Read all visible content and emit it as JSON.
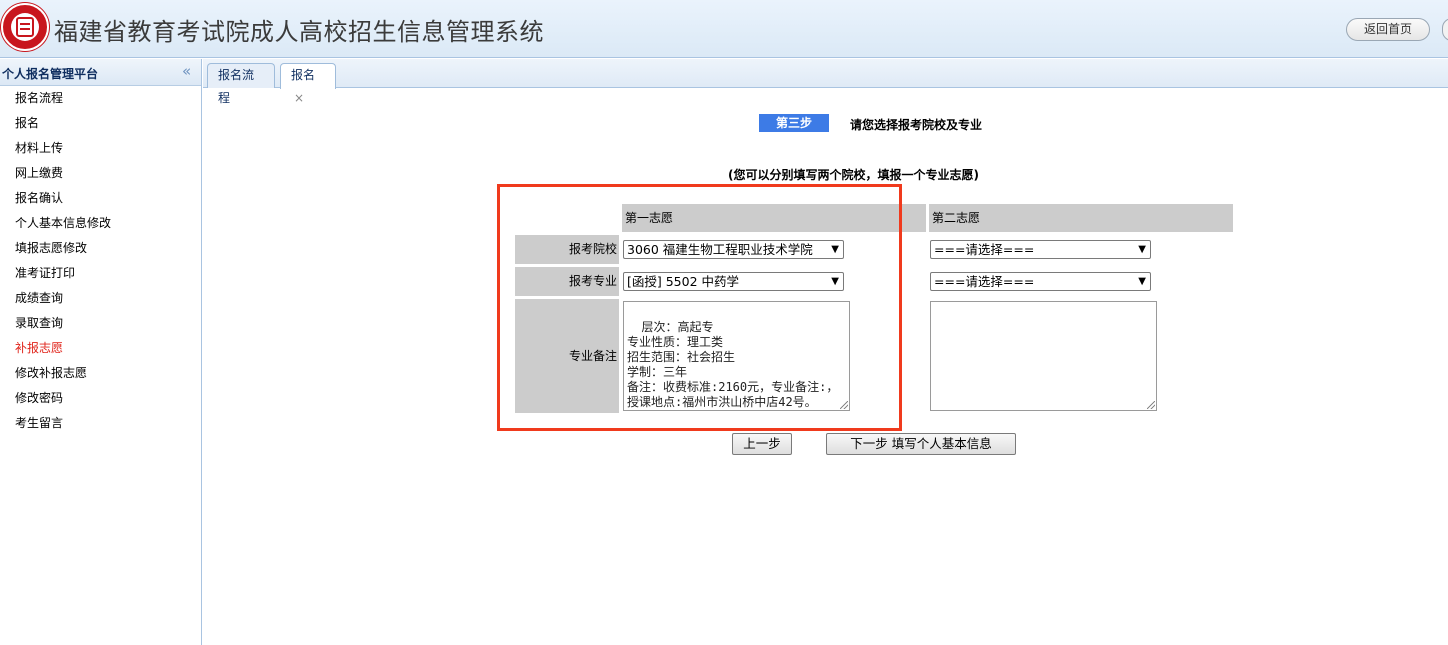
{
  "header": {
    "title": "福建省教育考试院成人高校招生信息管理系统",
    "home_button": "返回首页"
  },
  "sidebar": {
    "title": "个人报名管理平台",
    "collapse_icon": "double-chevron-left-icon",
    "items": [
      {
        "label": "报名流程"
      },
      {
        "label": "报名"
      },
      {
        "label": "材料上传"
      },
      {
        "label": "网上缴费"
      },
      {
        "label": "报名确认"
      },
      {
        "label": "个人基本信息修改"
      },
      {
        "label": "填报志愿修改"
      },
      {
        "label": "准考证打印"
      },
      {
        "label": "成绩查询"
      },
      {
        "label": "录取查询"
      },
      {
        "label": "补报志愿",
        "active": true
      },
      {
        "label": "修改补报志愿"
      },
      {
        "label": "修改密码"
      },
      {
        "label": "考生留言"
      }
    ]
  },
  "tabs": [
    {
      "label": "报名流程"
    },
    {
      "label": "报名",
      "close": "×"
    }
  ],
  "step": {
    "badge": "第三步",
    "text": "请您选择报考院校及专业",
    "hint": "(您可以分别填写两个院校，填报一个专业志愿)"
  },
  "form": {
    "col1_header": "第一志愿",
    "col2_header": "第二志愿",
    "labels": {
      "school": "报考院校",
      "major": "报考专业",
      "note": "专业备注"
    },
    "choice1": {
      "school": "3060 福建生物工程职业技术学院",
      "major": "[函授] 5502 中药学",
      "note": "层次：高起专\n专业性质：理工类\n招生范围：社会招生\n学制：三年\n备注：收费标准:2160元，专业备注:，授课地点:福州市洪山桥中店42号。"
    },
    "choice2": {
      "school": "===请选择===",
      "major": "===请选择===",
      "note": ""
    }
  },
  "buttons": {
    "prev": "上一步",
    "next": "下一步 填写个人基本信息"
  },
  "colors": {
    "step_badge": "#3d7be6",
    "highlight": "#f03a1d",
    "active_menu": "#e0241b"
  }
}
